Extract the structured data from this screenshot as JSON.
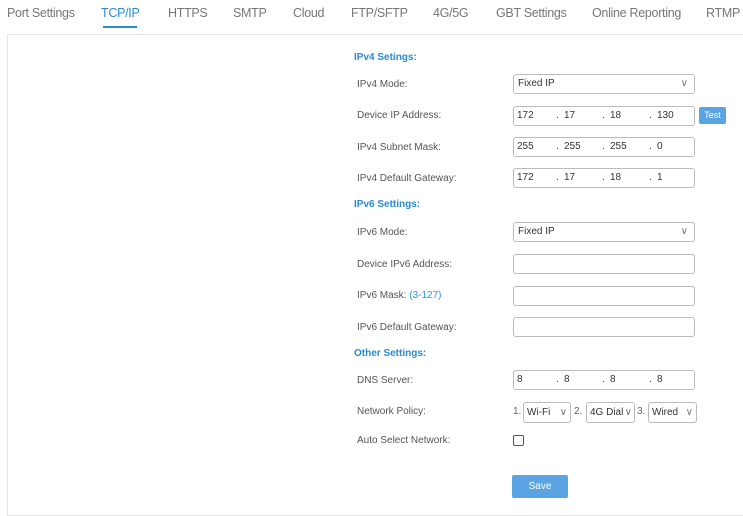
{
  "tabs": [
    "Port Settings",
    "TCP/IP",
    "HTTPS",
    "SMTP",
    "Cloud",
    "FTP/SFTP",
    "4G/5G",
    "GBT Settings",
    "Online Reporting",
    "RTMP"
  ],
  "active_tab": "TCP/IP",
  "ipv4": {
    "heading": "IPv4 Setings:",
    "mode_label": "IPv4 Mode:",
    "mode": "Fixed IP",
    "ip_label": "Device IP Address:",
    "ip": [
      "172",
      "17",
      "18",
      "130"
    ],
    "test": "Test",
    "mask_label": "IPv4 Subnet Mask:",
    "mask": [
      "255",
      "255",
      "255",
      "0"
    ],
    "gw_label": "IPv4 Default Gateway:",
    "gw": [
      "172",
      "17",
      "18",
      "1"
    ]
  },
  "ipv6": {
    "heading": "IPv6 Settings:",
    "mode_label": "IPv6 Mode:",
    "mode": "Fixed IP",
    "addr_label": "Device IPv6 Address:",
    "mask_label": "IPv6 Mask:",
    "mask_hint": "(3-127)",
    "gw_label": "IPv6 Default Gateway:"
  },
  "other": {
    "heading": "Other Settings:",
    "dns_label": "DNS Server:",
    "dns": [
      "8",
      "8",
      "8",
      "8"
    ],
    "policy_label": "Network Policy:",
    "policy": [
      {
        "n": "1.",
        "v": "Wi-Fi"
      },
      {
        "n": "2.",
        "v": "4G Dial"
      },
      {
        "n": "3.",
        "v": "Wired"
      }
    ],
    "auto_label": "Auto Select Network:",
    "auto_checked": false
  },
  "save": "Save"
}
